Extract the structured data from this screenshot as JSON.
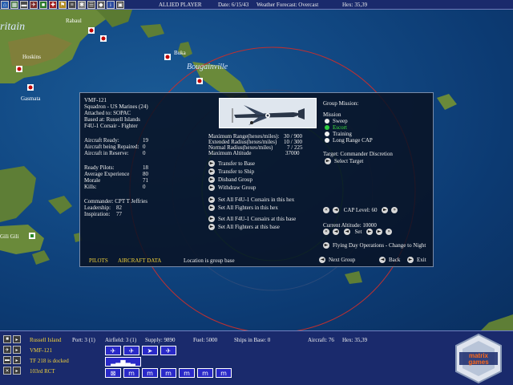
{
  "topbar": {
    "buttons": [
      "home-icon",
      "map-icon",
      "ship-icon",
      "plane-icon",
      "base-icon",
      "cross-icon",
      "flag-icon",
      "tf-icon",
      "gear-icon",
      "list-icon",
      "unit-icon",
      "info-icon",
      "end-icon"
    ],
    "side": "ALLIED PLAYER",
    "date": "Date: 6/15/43",
    "weather": "Weather Forecast: Overcast",
    "hex": "Hex: 35,39"
  },
  "map": {
    "region_labels": [
      "ritain",
      "Bougainville"
    ],
    "places": [
      "Rabaul",
      "Buka",
      "Hoskins",
      "Gasmata",
      "Gili Gili"
    ]
  },
  "dialog": {
    "unit_name": "VMF-121",
    "squadron": "Squadron - US Marines (24)",
    "attached": "Attached to:  SOPAC",
    "based": "Based at: Russell Islands",
    "aircraft_type": "F4U-1 Corsair - Fighter",
    "aircraft_stats": [
      {
        "label": "Aircraft Ready:",
        "value": "19"
      },
      {
        "label": "Aircraft being Repaired:",
        "value": "0"
      },
      {
        "label": "Aircraft in Reserve:",
        "value": "0"
      }
    ],
    "pilot_stats": [
      {
        "label": "Ready Pilots:",
        "value": "18"
      },
      {
        "label": "Average Experience",
        "value": "80"
      },
      {
        "label": "Morale",
        "value": "71"
      },
      {
        "label": "Kills:",
        "value": "0"
      }
    ],
    "commander": "Commander:  CPT T Jeffries",
    "leadership": {
      "label": "Leadership:",
      "value": "82"
    },
    "inspiration": {
      "label": "Inspiration:",
      "value": "77"
    },
    "range_stats": [
      {
        "label": "Maximum Range(hexes/miles):",
        "value": "30 / 900"
      },
      {
        "label": "Extended Radius(hexes/miles)",
        "value": "10 / 300"
      },
      {
        "label": "Normal Radius(hexes/miles)",
        "value": "7 / 225"
      },
      {
        "label": "Maximum Altitude",
        "value": "37000"
      }
    ],
    "actions_a": [
      "Transfer to Base",
      "Transfer to Ship",
      "Disband Group",
      "Withdraw Group"
    ],
    "actions_b": [
      "Set All F4U-1 Corsairs in this hex",
      "Set All Fighters in this hex"
    ],
    "actions_c": [
      "Set All F4U-1 Corsairs at this base",
      "Set All Fighters at this base"
    ],
    "group_mission": "Group Mission:",
    "mission_label": "Mission",
    "missions": [
      "Sweep",
      "Escort",
      "Training",
      "Long Range CAP"
    ],
    "selected_mission": "Escort",
    "target": "Target:  Commander Discretion",
    "select_target": "Select Target",
    "cap_level": "CAP Level: 60",
    "current_altitude": "Current Altitude:  10000",
    "set_label": "Set",
    "flying_ops": "Flying Day Operations - Change to Night",
    "tab_pilots": "PILOTS",
    "tab_aircraft": "AIRCRAFT DATA",
    "status": "Location is group base",
    "next_group": "Next Group",
    "back": "Back",
    "exit": "Exit"
  },
  "bottom": {
    "rows": [
      {
        "icon": "base-icon",
        "label": "Russell Island"
      },
      {
        "icon": "plane-icon",
        "label": "VMF-121"
      },
      {
        "icon": "ship-icon",
        "label": "TF 218 is docked"
      },
      {
        "icon": "troop-icon",
        "label": "103rd RCT"
      }
    ],
    "port": "Port: 3 (1)",
    "airfield": "Airfield: 3 (1)",
    "supply": "Supply: 9890",
    "fuel": "Fuel: 5000",
    "ships": "Ships in Base: 0",
    "aircraft": "Aircraft: 76",
    "hex": "Hex: 35,39",
    "logo_line1": "matrix",
    "logo_line2": "games"
  },
  "colors": {
    "ocean": "#124a85",
    "panel": "#1a2a6c",
    "tab_yellow": "#f2d23a",
    "selected_green": "#3ee03e",
    "range_red": "#c03030",
    "range_green": "#2e8b3a"
  }
}
